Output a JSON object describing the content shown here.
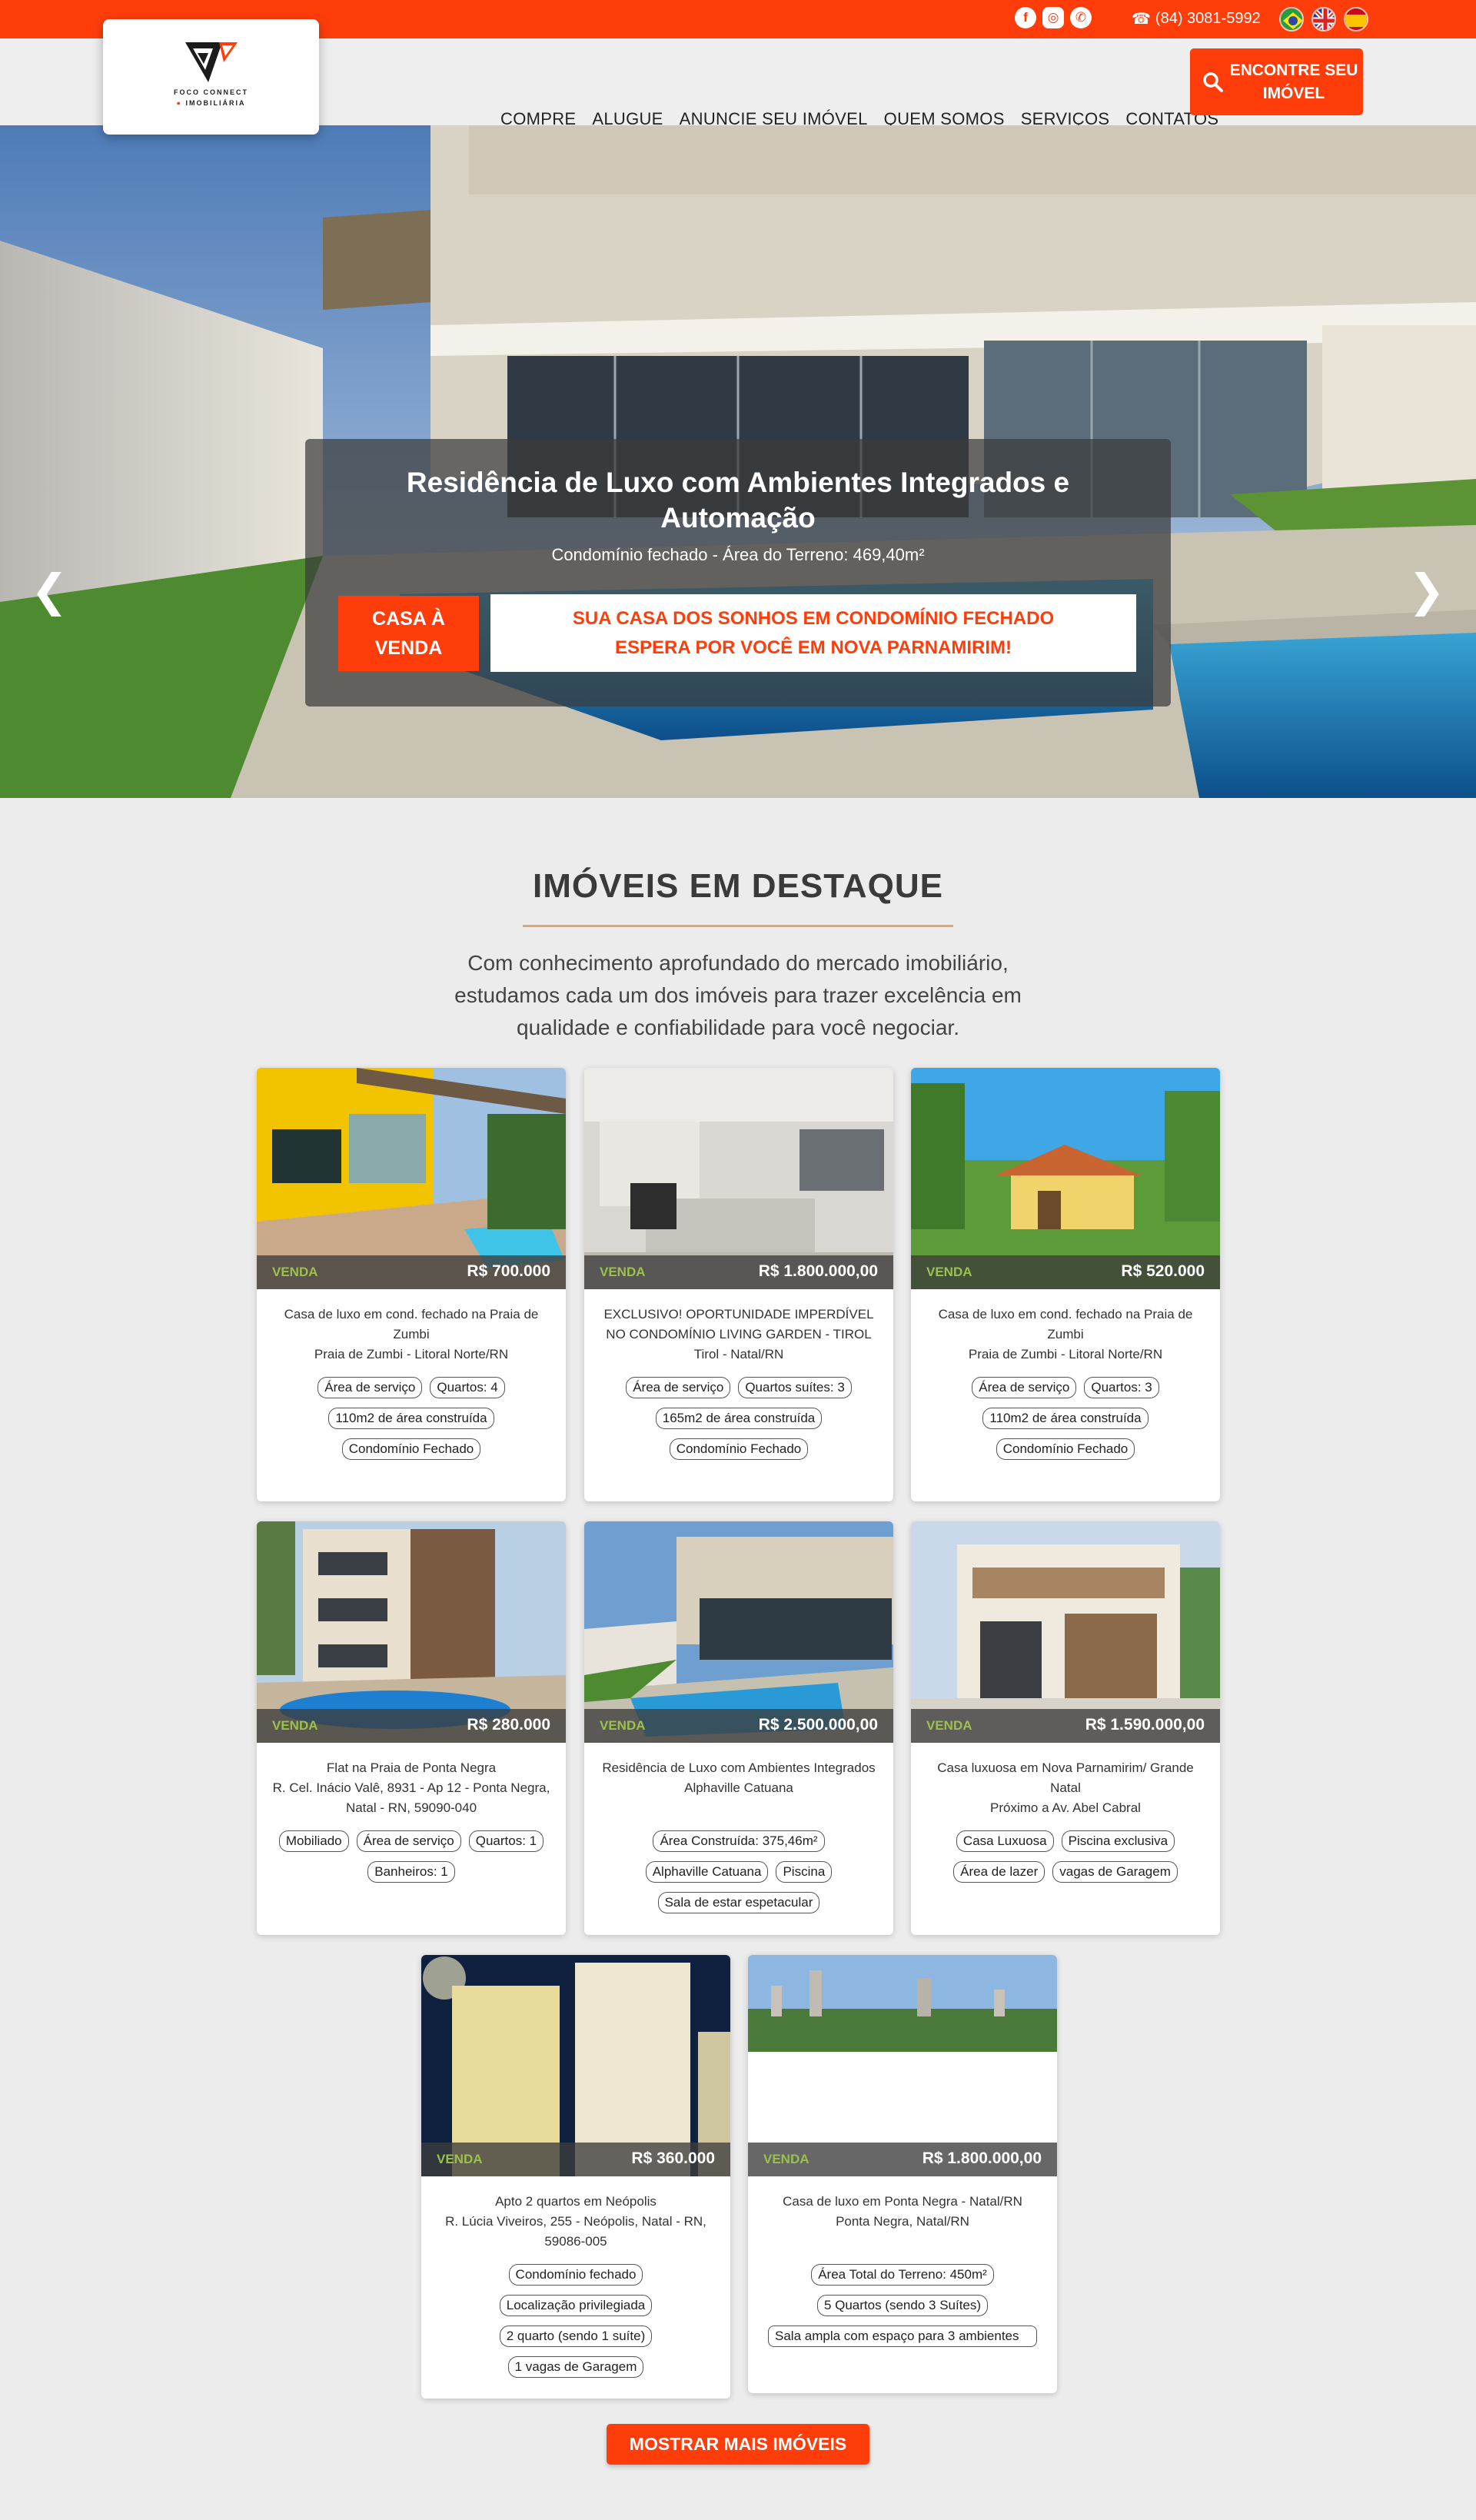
{
  "topbar": {
    "social_icons": [
      "facebook-icon",
      "instagram-icon",
      "whatsapp-icon"
    ],
    "phone": "(84) 3081-5992",
    "flags": [
      "brazil-flag",
      "uk-flag",
      "spain-flag"
    ]
  },
  "brand": {
    "line1": "FOCO CONNECT",
    "line2": "IMOBILIÁRIA"
  },
  "nav": [
    "COMPRE",
    "ALUGUE",
    "ANUNCIE SEU IMÓVEL",
    "QUEM SOMOS",
    "SERVIÇOS",
    "CONTATOS"
  ],
  "cta": {
    "label": "ENCONTRE SEU IMÓVEL"
  },
  "hero": {
    "title": "Residência de Luxo com Ambientes Integrados e Automação",
    "subtitle": "Condomínio fechado - Área do Terreno: 469,40m²",
    "badge": "CASA À VENDA",
    "cta": "SUA CASA DOS SONHOS EM CONDOMÍNIO FECHADO ESPERA POR VOCÊ EM NOVA PARNAMIRIM!",
    "prev": "❮",
    "next": "❯"
  },
  "section": {
    "title": "IMÓVEIS EM DESTAQUE",
    "description": "Com conhecimento aprofundado do mercado imobiliário, estudamos cada um dos imóveis para trazer excelência em qualidade e confiabilidade para você negociar."
  },
  "listings": [
    {
      "tag": "VENDA",
      "price": "R$ 700.000",
      "desc": [
        "Casa de luxo em cond. fechado na Praia de Zumbi",
        "Praia de Zumbi - Litoral Norte/RN"
      ],
      "chips": [
        "Área de serviço",
        "Quartos: 4",
        "110m2 de área construída",
        "Condomínio Fechado"
      ]
    },
    {
      "tag": "VENDA",
      "price": "R$ 1.800.000,00",
      "desc": [
        "EXCLUSIVO! OPORTUNIDADE IMPERDÍVEL NO CONDOMÍNIO LIVING GARDEN - TIROL",
        "Tirol - Natal/RN"
      ],
      "chips": [
        "Área de serviço",
        "Quartos suítes: 3",
        "165m2 de área construída",
        "Condomínio Fechado"
      ]
    },
    {
      "tag": "VENDA",
      "price": "R$ 520.000",
      "desc": [
        "Casa de luxo em cond. fechado na Praia de Zumbi",
        "Praia de Zumbi - Litoral Norte/RN"
      ],
      "chips": [
        "Área de serviço",
        "Quartos: 3",
        "110m2 de área construída",
        "Condomínio Fechado"
      ]
    },
    {
      "tag": "VENDA",
      "price": "R$ 280.000",
      "desc": [
        "Flat na Praia de Ponta Negra",
        "R. Cel. Inácio Valê, 8931 - Ap 12 - Ponta Negra, Natal - RN, 59090-040"
      ],
      "chips": [
        "Mobiliado",
        "Área de serviço",
        "Quartos: 1",
        "Banheiros: 1"
      ]
    },
    {
      "tag": "VENDA",
      "price": "R$ 2.500.000,00",
      "desc": [
        "Residência de Luxo com Ambientes Integrados",
        "Alphaville Catuana"
      ],
      "chips": [
        "Área Construída: 375,46m²",
        "Alphaville Catuana",
        "Piscina",
        "Sala de estar espetacular"
      ]
    },
    {
      "tag": "VENDA",
      "price": "R$ 1.590.000,00",
      "desc": [
        "Casa luxuosa em Nova Parnamirim/ Grande Natal",
        "Próximo a Av. Abel Cabral"
      ],
      "chips": [
        "Casa Luxuosa",
        "Piscina exclusiva",
        "Área de  lazer",
        "vagas de Garagem"
      ]
    },
    {
      "tag": "VENDA",
      "price": "R$ 360.000",
      "desc": [
        "Apto 2 quartos em Neópolis",
        "R. Lúcia Viveiros, 255 - Neópolis, Natal - RN, 59086-005"
      ],
      "chips": [
        "Condomínio fechado",
        "Localização privilegiada",
        "2 quarto (sendo 1 suíte)",
        "1 vagas de Garagem"
      ]
    },
    {
      "tag": "VENDA",
      "price": "R$ 1.800.000,00",
      "desc": [
        "Casa de luxo em Ponta Negra - Natal/RN",
        "Ponta Negra, Natal/RN"
      ],
      "chips": [
        "Área Total do Terreno: 450m²",
        "5 Quartos (sendo 3 Suítes)",
        "Sala ampla com espaço para 3 ambientes"
      ]
    }
  ],
  "more_button": "MOSTRAR MAIS IMÓVEIS",
  "colors": {
    "brand": "#ff3d0b",
    "tag_green": "#9ac24a"
  }
}
